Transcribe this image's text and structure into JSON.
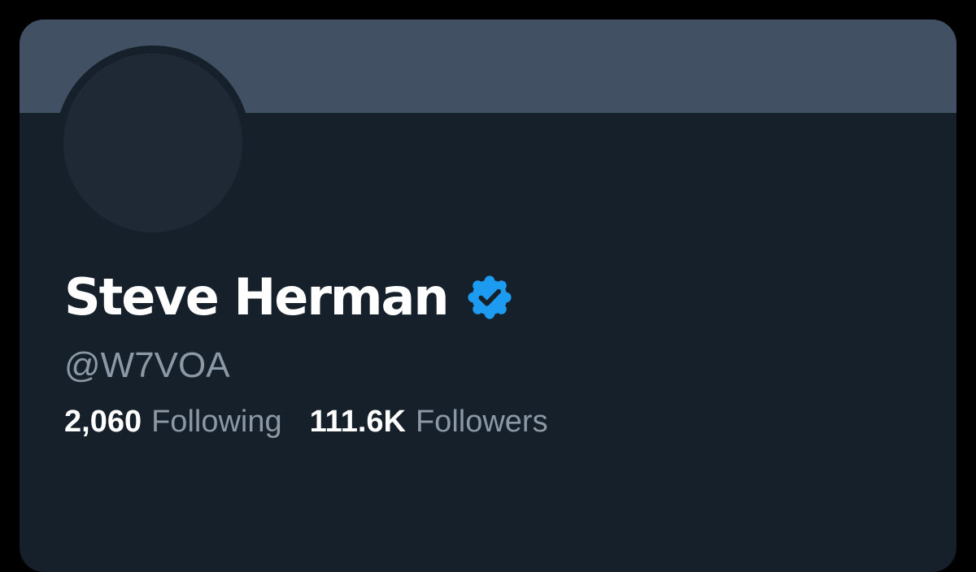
{
  "colors": {
    "page_background": "#000000",
    "card_background": "#15202b",
    "banner": "#415163",
    "avatar": "#1e2935",
    "primary_text": "#ffffff",
    "secondary_text": "#8b98a5",
    "verified_badge": "#1d9bf0"
  },
  "profile": {
    "display_name": "Steve Herman",
    "verified_icon": "verified-badge-icon",
    "handle": "@W7VOA"
  },
  "stats": {
    "following_count": "2,060",
    "following_label": "Following",
    "followers_count": "111.6K",
    "followers_label": "Followers"
  }
}
